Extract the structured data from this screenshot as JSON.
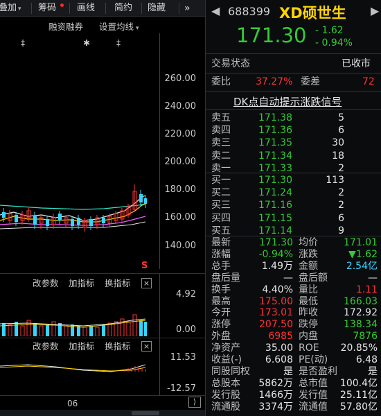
{
  "toolbar": {
    "items": [
      "叠加",
      "筹码",
      "画线",
      "简约",
      "隐藏"
    ],
    "more": "»"
  },
  "main_chart": {
    "options": [
      "融资融券",
      "设置均线"
    ],
    "y_ticks": [
      "260.00",
      "240.00",
      "220.00",
      "200.00",
      "180.00",
      "160.00",
      "140.00"
    ],
    "marker": "S",
    "colors": {
      "up": "#ff3333",
      "down": "#33d6ff",
      "ma5": "#e6e6e6",
      "ma10": "#ffd400",
      "ma20": "#ff55ff",
      "ma60": "#2ee6c8"
    }
  },
  "volume_panel": {
    "buttons": [
      "改参数",
      "加指标",
      "换指标"
    ],
    "close": "×",
    "y_ticks": [
      "4.92",
      "0.00"
    ]
  },
  "macd_panel": {
    "buttons": [
      "改参数",
      "加指标",
      "换指标"
    ],
    "close": "×",
    "y_ticks": [
      "11.53",
      "-12.57"
    ]
  },
  "x_axis": {
    "label": "06"
  },
  "scroll": {
    "arrow": "⟩"
  },
  "quote": {
    "code": "688399",
    "name": "XD硕世生",
    "price": "171.30",
    "change": "- 1.62",
    "change_pct": "- 0.94%",
    "status_label": "交易状态",
    "status_value": "已收市",
    "weibi_label": "委比",
    "weibi_value": "37.27%",
    "weicha_label": "委差",
    "weicha_value": "72",
    "dk_link": "DK点自动提示涨跌信号",
    "asks": [
      {
        "label": "卖五",
        "price": "171.38",
        "vol": "5"
      },
      {
        "label": "卖四",
        "price": "171.36",
        "vol": "6"
      },
      {
        "label": "卖三",
        "price": "171.35",
        "vol": "30"
      },
      {
        "label": "卖二",
        "price": "171.34",
        "vol": "18"
      },
      {
        "label": "卖一",
        "price": "171.33",
        "vol": "2"
      }
    ],
    "bids": [
      {
        "label": "买一",
        "price": "171.30",
        "vol": "113"
      },
      {
        "label": "买二",
        "price": "171.24",
        "vol": "2"
      },
      {
        "label": "买三",
        "price": "171.16",
        "vol": "2"
      },
      {
        "label": "买四",
        "price": "171.15",
        "vol": "6"
      },
      {
        "label": "买五",
        "price": "171.14",
        "vol": "9"
      }
    ],
    "stats": [
      {
        "l1": "最新",
        "v1": "171.30",
        "c1": "green",
        "l2": "均价",
        "v2": "171.01",
        "c2": "green"
      },
      {
        "l1": "涨幅",
        "v1": "-0.94%",
        "c1": "green",
        "l2": "涨跌",
        "v2": "▼1.62",
        "c2": "green"
      },
      {
        "l1": "总手",
        "v1": "1.49万",
        "c1": "white",
        "l2": "金额",
        "v2": "2.54亿",
        "c2": "cyan"
      },
      {
        "l1": "盘后量",
        "v1": "—",
        "c1": "white",
        "l2": "盘后额",
        "v2": "—",
        "c2": "white"
      },
      {
        "l1": "换手",
        "v1": "4.40%",
        "c1": "white",
        "l2": "量比",
        "v2": "1.11",
        "c2": "red"
      },
      {
        "l1": "最高",
        "v1": "175.00",
        "c1": "red",
        "l2": "最低",
        "v2": "166.03",
        "c2": "green"
      },
      {
        "l1": "今开",
        "v1": "173.01",
        "c1": "red",
        "l2": "昨收",
        "v2": "172.92",
        "c2": "white"
      },
      {
        "l1": "涨停",
        "v1": "207.50",
        "c1": "red",
        "l2": "跌停",
        "v2": "138.34",
        "c2": "green"
      },
      {
        "l1": "外盘",
        "v1": "6985",
        "c1": "red",
        "l2": "内盘",
        "v2": "7876",
        "c2": "green"
      },
      {
        "l1": "净资产",
        "v1": "35.00",
        "c1": "white",
        "l2": "ROE",
        "v2": "20.85%",
        "c2": "white"
      },
      {
        "l1": "收益(-)",
        "v1": "6.608",
        "c1": "white",
        "l2": "PE(动)",
        "v2": "6.48",
        "c2": "white"
      },
      {
        "l1": "同股同权",
        "v1": "是",
        "c1": "white",
        "l2": "是否盈利",
        "v2": "是",
        "c2": "white"
      },
      {
        "l1": "总股本",
        "v1": "5862万",
        "c1": "white",
        "l2": "总市值",
        "v2": "100.4亿",
        "c2": "white"
      },
      {
        "l1": "发行股",
        "v1": "1466万",
        "c1": "white",
        "l2": "发行值",
        "v2": "25.11亿",
        "c2": "white"
      },
      {
        "l1": "流通股",
        "v1": "3374万",
        "c1": "white",
        "l2": "流通值",
        "v2": "57.80亿",
        "c2": "white"
      }
    ]
  }
}
